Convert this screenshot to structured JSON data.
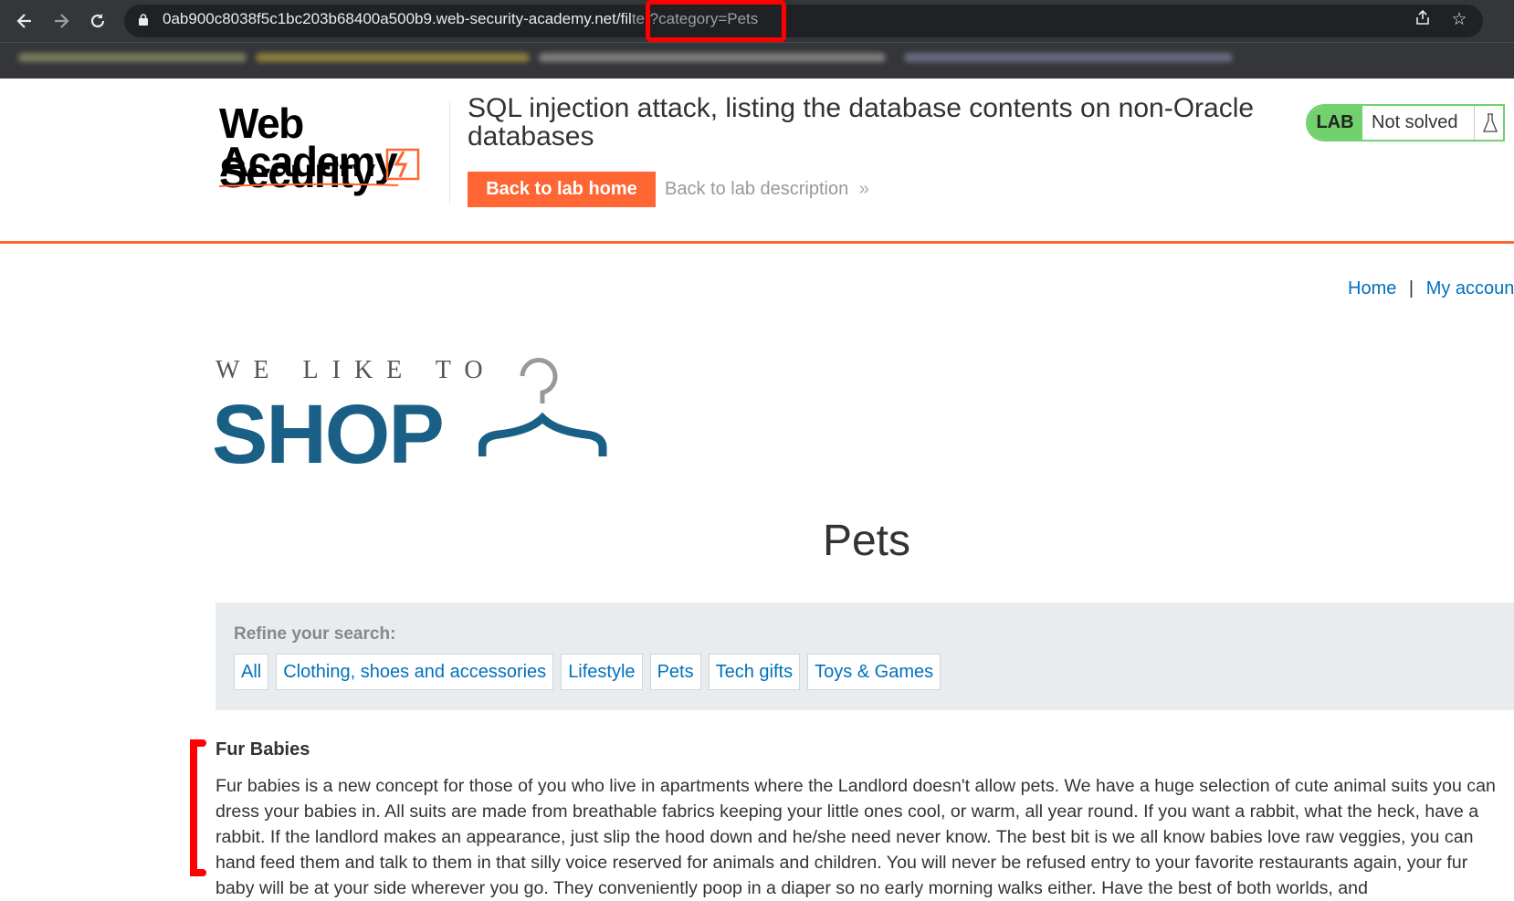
{
  "browser": {
    "url_main": "0ab900c8038f5c1bc203b68400a500b9.web-security-academy.net/fil",
    "url_query": "ter?category=Pets",
    "icons": [
      "back-icon",
      "forward-icon",
      "reload-icon",
      "lock-icon",
      "share-icon",
      "star-icon"
    ]
  },
  "lab": {
    "logo_line1": "Web Security",
    "logo_line2": "Academy",
    "title": "SQL injection attack, listing the database contents on non-Oracle databases",
    "back_home": "Back to lab home",
    "back_description": "Back to lab description",
    "badge_tag": "LAB",
    "status": "Not solved",
    "accent": "#ff6633",
    "status_color": "#70d16d"
  },
  "site": {
    "nav_home": "Home",
    "nav_sep": "|",
    "nav_account": "My account",
    "logo_top": "WE LIKE TO",
    "logo_main": "SHOP",
    "category_title": "Pets",
    "refine_label": "Refine your search:",
    "filters": [
      "All",
      "Clothing, shoes and accessories",
      "Lifestyle",
      "Pets",
      "Tech gifts",
      "Toys & Games"
    ],
    "brand_color": "#1a5f86"
  },
  "product": {
    "name": "Fur Babies",
    "description": "Fur babies is a new concept for those of you who live in apartments where the Landlord doesn't allow pets. We have a huge selection of cute animal suits you can dress your babies in. All suits are made from breathable fabrics keeping your little ones cool, or warm, all year round. If you want a rabbit, what the heck, have a rabbit. If the landlord makes an appearance, just slip the hood down and he/she need never know. The best bit is we all know babies love raw veggies, you can hand feed them and talk to them in that silly voice reserved for animals and children. You will never be refused entry to your favorite restaurants again, your fur baby will be at your side wherever you go. They conveniently poop in a diaper so no early morning walks either. Have the best of both worlds, and"
  }
}
